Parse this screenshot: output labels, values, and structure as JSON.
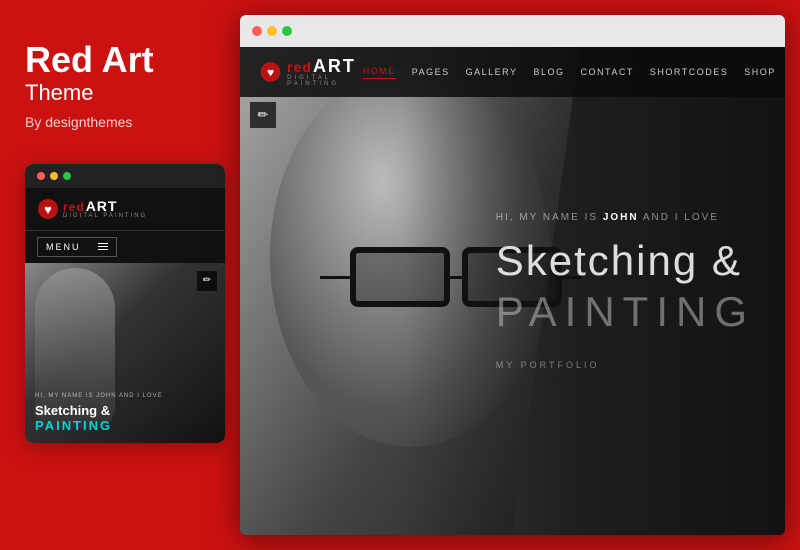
{
  "left": {
    "title": "Red Art",
    "subtitle": "Theme",
    "by": "By designthemes"
  },
  "mobile": {
    "logo": {
      "red": "red",
      "art": "ART",
      "sub": "DIGITAL PAINTING"
    },
    "menu": "MENU",
    "hero": {
      "hi": "HI, MY NAME IS JOHN AND I LOVE",
      "sketching": "Sketching &",
      "painting": "PAINTING"
    }
  },
  "desktop": {
    "nav": {
      "logo": {
        "red": "red",
        "art": "ART",
        "sub": "DIGITAL PAINTING"
      },
      "items": [
        {
          "label": "HOME",
          "active": true
        },
        {
          "label": "PAGES",
          "active": false
        },
        {
          "label": "GALLERY",
          "active": false
        },
        {
          "label": "BLOG",
          "active": false
        },
        {
          "label": "CONTACT",
          "active": false
        },
        {
          "label": "SHORTCODES",
          "active": false
        },
        {
          "label": "SHOP",
          "active": false
        }
      ]
    },
    "hero": {
      "hi": "HI, MY NAME IS",
      "name": "JOHN",
      "love": "AND I LOVE",
      "sketching": "Sketching &",
      "painting": "PAINTING",
      "portfolio": "MY PORTFOLIO"
    }
  },
  "colors": {
    "red": "#cc1111",
    "nav_bg": "rgba(10,10,10,0.85)",
    "hero_bg": "#1a1a1a"
  }
}
